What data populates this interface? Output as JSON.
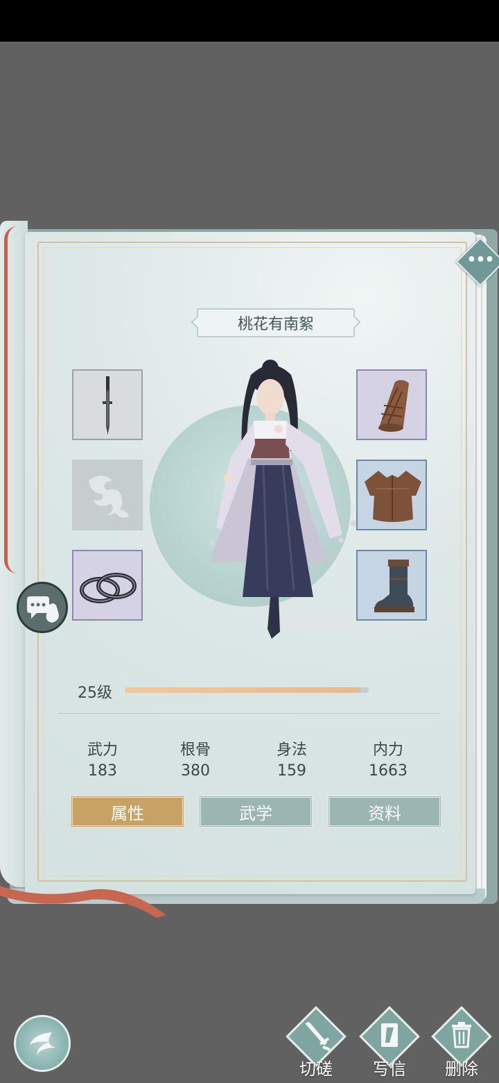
{
  "character": {
    "name": "桃花有南絮",
    "level_label": "25级",
    "level_progress": 0.97
  },
  "stats": [
    {
      "label": "武力",
      "value": "183"
    },
    {
      "label": "根骨",
      "value": "380"
    },
    {
      "label": "身法",
      "value": "159"
    },
    {
      "label": "内力",
      "value": "1663"
    }
  ],
  "tabs": [
    {
      "label": "属性",
      "active": true
    },
    {
      "label": "武学",
      "active": false
    },
    {
      "label": "资料",
      "active": false
    }
  ],
  "equipment": {
    "left": [
      "dagger-icon",
      "empty-slot-icon",
      "bracelets-icon"
    ],
    "right": [
      "bracer-icon",
      "chest-armor-icon",
      "boot-icon"
    ]
  },
  "actions": [
    {
      "label": "切磋",
      "icon": "sword-icon"
    },
    {
      "label": "写信",
      "icon": "letter-icon"
    },
    {
      "label": "删除",
      "icon": "trash-icon"
    }
  ],
  "colors": {
    "active_tab": "#c8a265",
    "inactive_tab": "#9ab5b2",
    "level_fill": "#eab98b",
    "accent": "#7fa5a1"
  }
}
